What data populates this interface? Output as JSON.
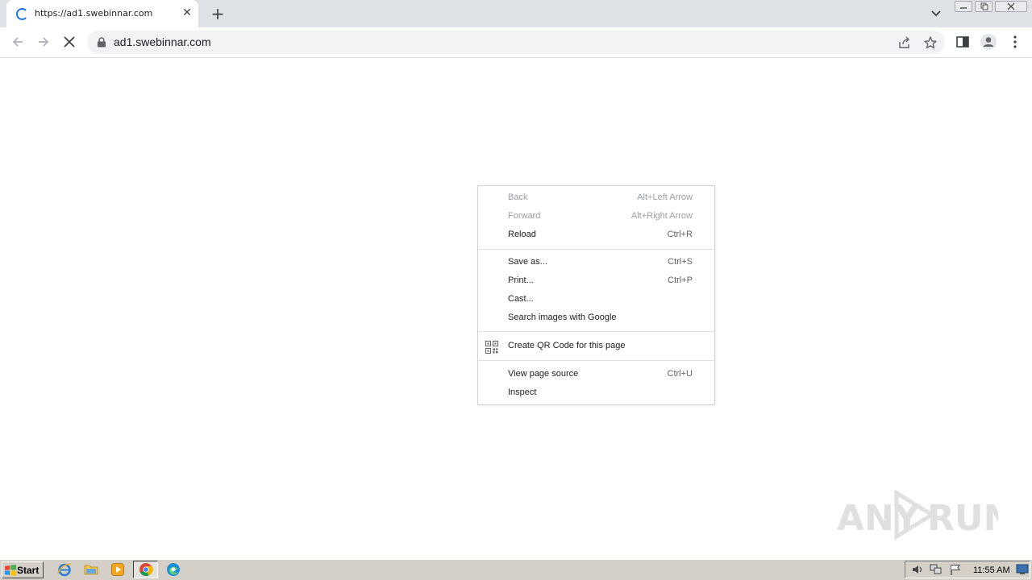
{
  "browser": {
    "tab": {
      "title": "https://ad1.swebinnar.com"
    },
    "omnibox": {
      "url": "ad1.swebinnar.com"
    }
  },
  "context_menu": {
    "items": [
      {
        "label": "Back",
        "shortcut": "Alt+Left Arrow",
        "disabled": true
      },
      {
        "label": "Forward",
        "shortcut": "Alt+Right Arrow",
        "disabled": true
      },
      {
        "label": "Reload",
        "shortcut": "Ctrl+R",
        "disabled": false
      },
      {
        "label": "Save as...",
        "shortcut": "Ctrl+S",
        "disabled": false
      },
      {
        "label": "Print...",
        "shortcut": "Ctrl+P",
        "disabled": false
      },
      {
        "label": "Cast...",
        "shortcut": "",
        "disabled": false
      },
      {
        "label": "Search images with Google",
        "shortcut": "",
        "disabled": false
      },
      {
        "label": "Create QR Code for this page",
        "shortcut": "",
        "disabled": false,
        "icon": "qr-code-icon"
      },
      {
        "label": "View page source",
        "shortcut": "Ctrl+U",
        "disabled": false
      },
      {
        "label": "Inspect",
        "shortcut": "",
        "disabled": false
      }
    ]
  },
  "watermark": {
    "text_left": "ANY",
    "text_right": "RUN"
  },
  "taskbar": {
    "start_label": "Start",
    "clock": "11:55 AM",
    "pinned": [
      "internet-explorer-icon",
      "folder-icon",
      "media-player-icon",
      "chrome-icon",
      "edge-icon"
    ]
  },
  "colors": {
    "accent": "#1a73e8",
    "tabstrip": "#dee1e6",
    "taskbar": "#d4d0c8"
  }
}
